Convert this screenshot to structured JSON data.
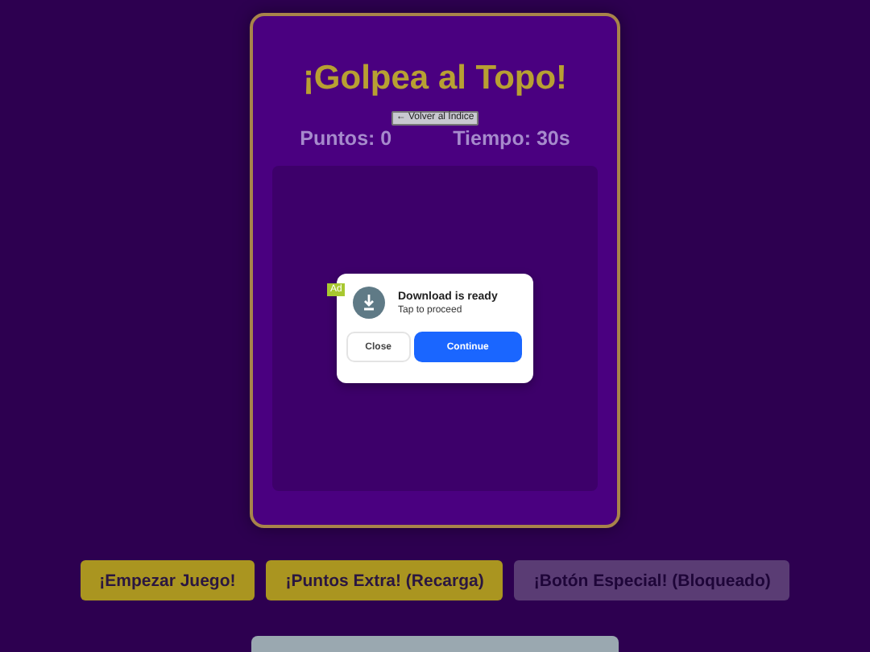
{
  "game": {
    "title": "¡Golpea al Topo!",
    "back_link": "← Volver al Índice",
    "score": "Puntos: 0",
    "time": "Tiempo: 30s"
  },
  "ad": {
    "badge": "Ad",
    "title": "Download is ready",
    "subtitle": "Tap to proceed",
    "buttons": [
      {
        "label": "Close",
        "kind": "secondary"
      },
      {
        "label": "Continue",
        "kind": "primary"
      }
    ]
  },
  "buttons": [
    {
      "label": "¡Empezar Juego!",
      "disabled": false
    },
    {
      "label": "¡Puntos Extra! (Recarga)",
      "disabled": false
    },
    {
      "label": "¡Botón Especial! (Bloqueado)",
      "disabled": true
    }
  ]
}
